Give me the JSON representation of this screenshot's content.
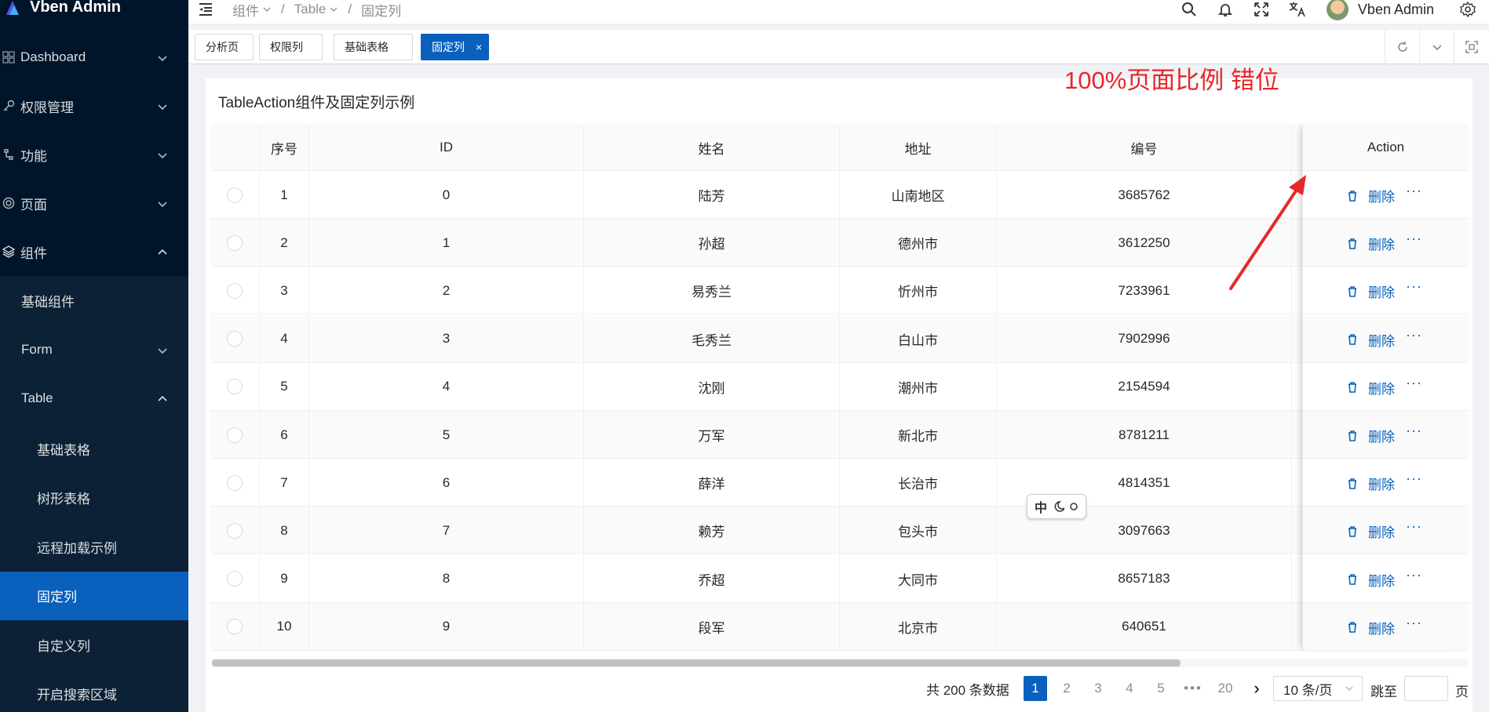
{
  "app": {
    "title": "Vben Admin"
  },
  "sidebar": {
    "items": [
      {
        "label": "Dashboard",
        "icon": "grid-icon",
        "expanded": false
      },
      {
        "label": "权限管理",
        "icon": "key-icon",
        "expanded": false
      },
      {
        "label": "功能",
        "icon": "tool-icon",
        "expanded": false
      },
      {
        "label": "页面",
        "icon": "page-icon",
        "expanded": false
      },
      {
        "label": "组件",
        "icon": "layers-icon",
        "expanded": true
      }
    ],
    "sub_items": [
      {
        "label": "基础组件"
      },
      {
        "label": "Form",
        "expandable": true
      },
      {
        "label": "Table",
        "expandable": true,
        "expanded": true
      }
    ],
    "table_items": [
      {
        "label": "基础表格"
      },
      {
        "label": "树形表格"
      },
      {
        "label": "远程加载示例"
      },
      {
        "label": "固定列",
        "active": true
      },
      {
        "label": "自定义列"
      },
      {
        "label": "开启搜索区域"
      }
    ]
  },
  "header": {
    "breadcrumb": [
      "组件",
      "Table",
      "固定列"
    ],
    "username": "Vben Admin",
    "icons": [
      "search-icon",
      "bell-icon",
      "fullscreen-icon",
      "translate-icon",
      "settings-icon"
    ]
  },
  "tabs": [
    {
      "label": "分析页"
    },
    {
      "label": "权限列"
    },
    {
      "label": "基础表格"
    },
    {
      "label": "固定列",
      "active": true,
      "close": "×"
    }
  ],
  "page": {
    "title": "TableAction组件及固定列示例",
    "annotation": "100%页面比例 错位"
  },
  "table": {
    "columns": [
      "序号",
      "ID",
      "姓名",
      "地址",
      "编号",
      "Action"
    ],
    "rows": [
      {
        "no": "1",
        "id": "0",
        "name": "陆芳",
        "addr": "山南地区",
        "code": "3685762"
      },
      {
        "no": "2",
        "id": "1",
        "name": "孙超",
        "addr": "德州市",
        "code": "3612250"
      },
      {
        "no": "3",
        "id": "2",
        "name": "易秀兰",
        "addr": "忻州市",
        "code": "7233961"
      },
      {
        "no": "4",
        "id": "3",
        "name": "毛秀兰",
        "addr": "白山市",
        "code": "7902996"
      },
      {
        "no": "5",
        "id": "4",
        "name": "沈刚",
        "addr": "潮州市",
        "code": "2154594"
      },
      {
        "no": "6",
        "id": "5",
        "name": "万军",
        "addr": "新北市",
        "code": "8781211"
      },
      {
        "no": "7",
        "id": "6",
        "name": "薛洋",
        "addr": "长治市",
        "code": "4814351"
      },
      {
        "no": "8",
        "id": "7",
        "name": "赖芳",
        "addr": "包头市",
        "code": "3097663"
      },
      {
        "no": "9",
        "id": "8",
        "name": "乔超",
        "addr": "大同市",
        "code": "8657183"
      },
      {
        "no": "10",
        "id": "9",
        "name": "段军",
        "addr": "北京市",
        "code": "640651"
      }
    ],
    "action_delete": "删除",
    "action_more": "···"
  },
  "ime": {
    "text": "中"
  },
  "pagination": {
    "total": "共 200 条数据",
    "pages": [
      "1",
      "2",
      "3",
      "4",
      "5"
    ],
    "ellipsis": "•••",
    "last": "20",
    "next": "›",
    "current": "1",
    "page_size": "10 条/页",
    "jump_label": "跳至",
    "jump_suffix": "页"
  },
  "colors": {
    "primary": "#0960bd",
    "sidebar": "#001529",
    "annotation": "#e8262a"
  }
}
